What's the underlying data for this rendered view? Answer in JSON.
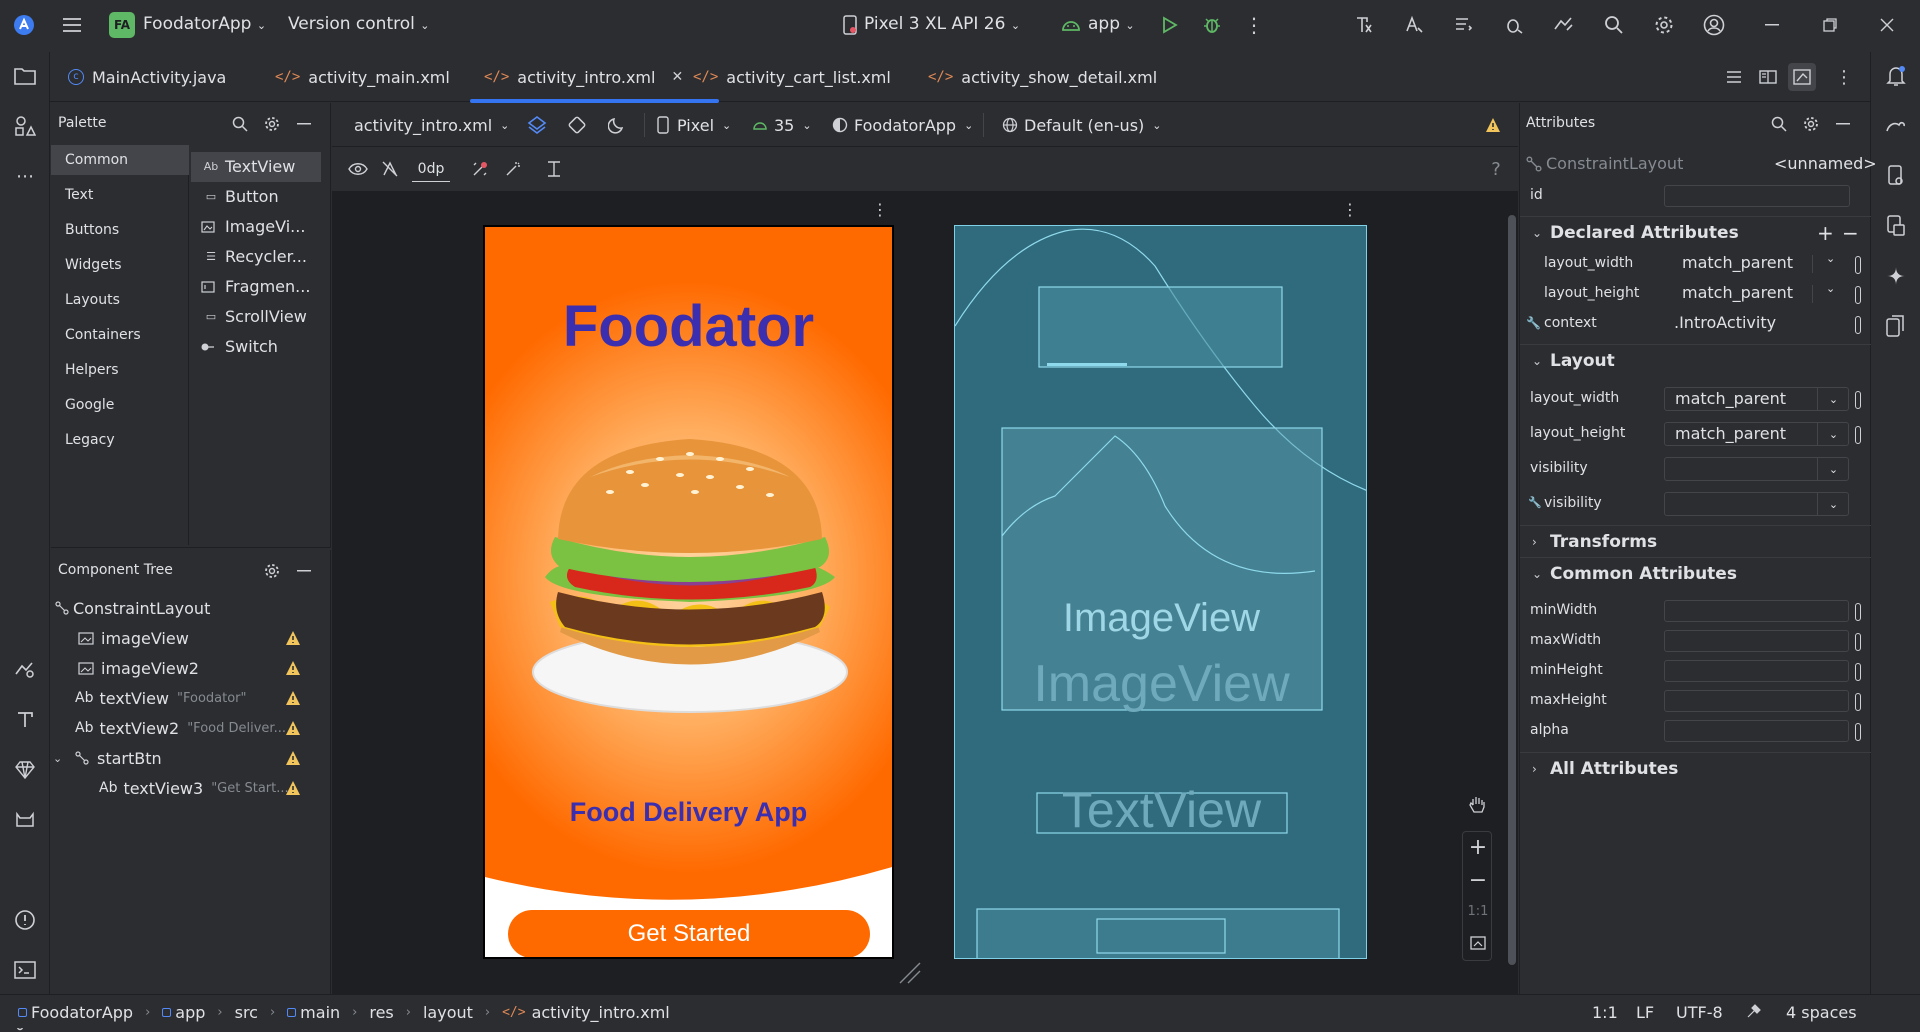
{
  "titlebar": {
    "logo_icon": "android-studio-icon",
    "menu_icon": "hamburger-icon",
    "project_badge": "FA",
    "project_name": "FoodatorApp",
    "vcs_label": "Version control",
    "device": "Pixel 3 XL API 26",
    "run_config": "app",
    "accent": "#3574f0"
  },
  "tabs": [
    {
      "label": "MainActivity.java",
      "type": "java"
    },
    {
      "label": "activity_main.xml",
      "type": "xml"
    },
    {
      "label": "activity_intro.xml",
      "type": "xml",
      "active": true
    },
    {
      "label": "activity_cart_list.xml",
      "type": "xml"
    },
    {
      "label": "activity_show_detail.xml",
      "type": "xml"
    }
  ],
  "palette": {
    "title": "Palette",
    "categories": [
      "Common",
      "Text",
      "Buttons",
      "Widgets",
      "Layouts",
      "Containers",
      "Helpers",
      "Google",
      "Legacy"
    ],
    "items": [
      {
        "label": "TextView",
        "icon": "Ab"
      },
      {
        "label": "Button",
        "icon": "▭"
      },
      {
        "label": "ImageVi...",
        "icon": "🖼"
      },
      {
        "label": "Recycler...",
        "icon": "☰"
      },
      {
        "label": "Fragmen...",
        "icon": "▯"
      },
      {
        "label": "ScrollView",
        "icon": "▭"
      },
      {
        "label": "Switch",
        "icon": "⊸"
      }
    ]
  },
  "tree": {
    "title": "Component Tree",
    "nodes": [
      {
        "label": "ConstraintLayout",
        "prefix": "",
        "sub": ""
      },
      {
        "label": "imageView",
        "prefix": "",
        "sub": ""
      },
      {
        "label": "imageView2",
        "prefix": "",
        "sub": ""
      },
      {
        "label": "textView",
        "prefix": "Ab",
        "sub": "\"Foodator\""
      },
      {
        "label": "textView2",
        "prefix": "Ab",
        "sub": "\"Food Deliver..."
      },
      {
        "label": "startBtn",
        "prefix": "",
        "sub": ""
      },
      {
        "label": "textView3",
        "prefix": "Ab",
        "sub": "\"Get Start..."
      }
    ]
  },
  "editor": {
    "file": "activity_intro.xml",
    "device": "Pixel",
    "api": "35",
    "theme": "FoodatorApp",
    "locale": "Default (en-us)",
    "margin": "0dp",
    "zoom_label": "1:1"
  },
  "preview": {
    "title": "Foodator",
    "subtitle": "Food Delivery App",
    "button": "Get Started",
    "bg_color": "#ff6a00",
    "title_color": "#3b2fb0"
  },
  "blueprint": {
    "label_image1": "ImageView",
    "label_image2": "ImageView",
    "label_text": "TextView",
    "bg_color": "#2f6a7d"
  },
  "attributes": {
    "title": "Attributes",
    "component": "ConstraintLayout",
    "component_name": "<unnamed>",
    "id_label": "id",
    "declared_title": "Declared Attributes",
    "declared": [
      {
        "name": "layout_width",
        "value": "match_parent"
      },
      {
        "name": "layout_height",
        "value": "match_parent"
      },
      {
        "name": "context",
        "value": ".IntroActivity"
      }
    ],
    "layout_title": "Layout",
    "layout": [
      {
        "name": "layout_width",
        "value": "match_parent"
      },
      {
        "name": "layout_height",
        "value": "match_parent"
      },
      {
        "name": "visibility",
        "value": ""
      },
      {
        "name": "visibility",
        "value": ""
      }
    ],
    "transforms_title": "Transforms",
    "common_title": "Common Attributes",
    "common": [
      "minWidth",
      "maxWidth",
      "minHeight",
      "maxHeight",
      "alpha"
    ],
    "all_title": "All Attributes"
  },
  "status": {
    "crumbs": [
      "FoodatorApp",
      "app",
      "src",
      "main",
      "res",
      "layout",
      "activity_intro.xml"
    ],
    "position": "1:1",
    "line_ending": "LF",
    "encoding": "UTF-8",
    "indent": "4 spaces"
  }
}
